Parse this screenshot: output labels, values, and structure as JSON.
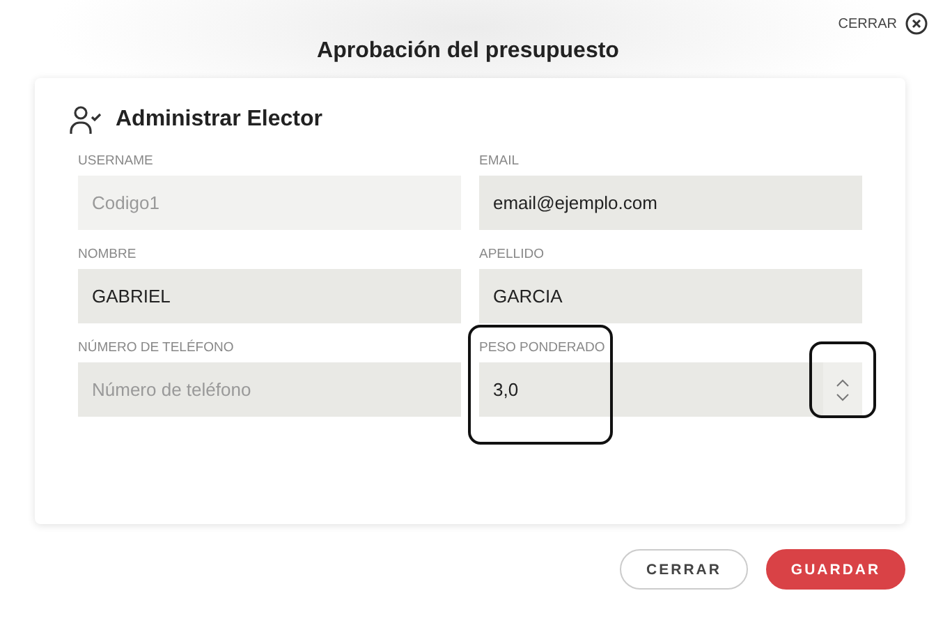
{
  "close_link": {
    "label": "CERRAR"
  },
  "title": "Aprobación del presupuesto",
  "card": {
    "heading": "Administrar Elector",
    "fields": [
      {
        "label": "USERNAME",
        "kind": "text",
        "value": "Codigo1",
        "disabled": true,
        "highlighted": false
      },
      {
        "label": "EMAIL",
        "kind": "text",
        "value": "email@ejemplo.com",
        "disabled": false,
        "highlighted": false
      },
      {
        "label": "NOMBRE",
        "kind": "text",
        "value": "GABRIEL",
        "disabled": false,
        "highlighted": false
      },
      {
        "label": "APELLIDO",
        "kind": "text",
        "value": "GARCIA",
        "disabled": false,
        "highlighted": false
      },
      {
        "label": "NÚMERO DE TELÉFONO",
        "kind": "text",
        "placeholder": "Número de teléfono",
        "disabled": false,
        "highlighted": false
      },
      {
        "label": "PESO PONDERADO",
        "kind": "number",
        "value": "3,0",
        "disabled": false,
        "highlighted": true
      }
    ]
  },
  "buttons": [
    {
      "label": "CERRAR",
      "kind": "secondary"
    },
    {
      "label": "GUARDAR",
      "kind": "primary"
    }
  ]
}
